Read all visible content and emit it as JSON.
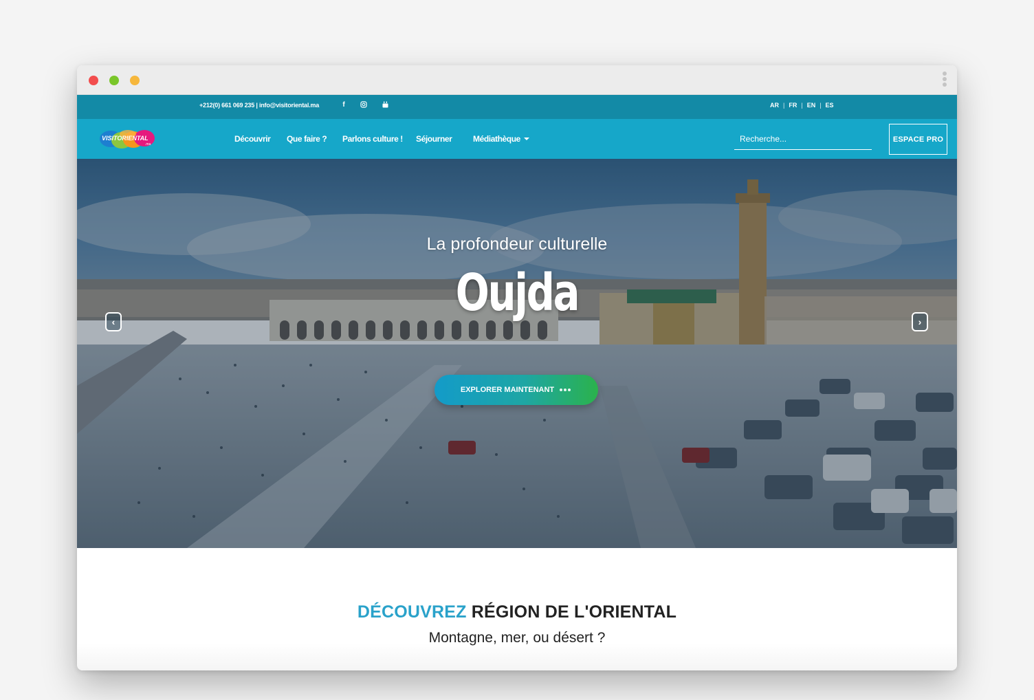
{
  "topbar": {
    "contact": "+212(0) 661 069 235 | info@visitoriental.ma",
    "languages": [
      "AR",
      "FR",
      "EN",
      "ES"
    ],
    "social": [
      "facebook-icon",
      "instagram-icon",
      "youtube-icon"
    ]
  },
  "navbar": {
    "logo_text": "VISITORIENTAL",
    "logo_suffix": ".ma",
    "items": [
      {
        "label": "Découvrir"
      },
      {
        "label": "Que faire ?"
      },
      {
        "label": "Parlons culture !"
      },
      {
        "label": "Séjourner"
      },
      {
        "label": "Médiathèque"
      }
    ],
    "search_placeholder": "Recherche...",
    "espace_pro": "ESPACE PRO"
  },
  "hero": {
    "subtitle": "La profondeur culturelle",
    "title": "Oujda",
    "cta": "EXPLORER MAINTENANT"
  },
  "section": {
    "title_accent": "DÉCOUVREZ",
    "title_rest": "RÉGION DE L'ORIENTAL",
    "subtitle": "Montagne, mer, ou désert ?"
  },
  "colors": {
    "topbar": "#138aa6",
    "navbar": "#16a7c9",
    "accent": "#2aa2ca",
    "cta_start": "#139bc9",
    "cta_end": "#2bb24c"
  }
}
